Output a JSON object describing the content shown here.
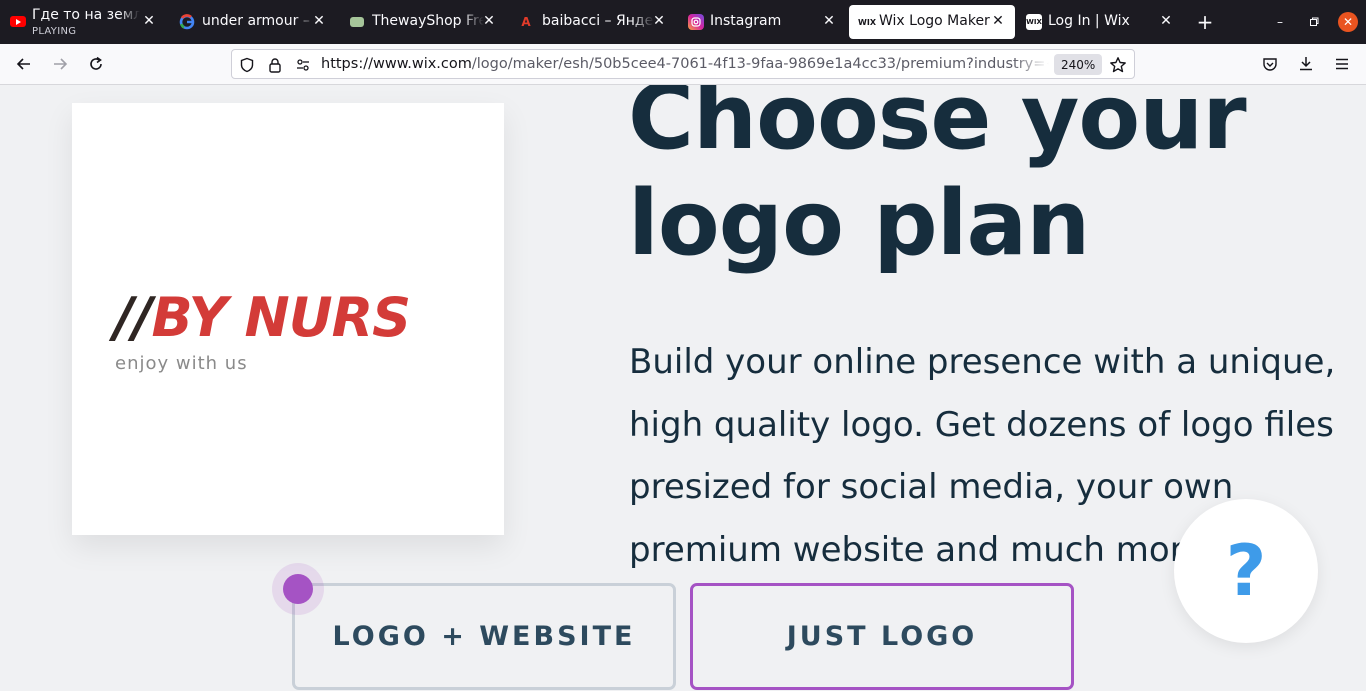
{
  "tabs": [
    {
      "title": "Где то на земле",
      "subtitle": "PLAYING",
      "favicon": "youtube-icon",
      "favicon_color": "#ff0000"
    },
    {
      "title": "under armour – G",
      "favicon": "google-icon",
      "favicon_color": "#4285f4"
    },
    {
      "title": "ThewayShop Free",
      "favicon": "site-icon",
      "favicon_color": "#a6c59a"
    },
    {
      "title": "baibacci – Яндекс",
      "favicon": "yandex-translate-icon",
      "favicon_color": "#e23b2a"
    },
    {
      "title": "Instagram",
      "favicon": "instagram-icon",
      "favicon_color": "#d6249f"
    },
    {
      "title": "Wix Logo Maker",
      "favicon": "wix-icon",
      "favicon_color": "#ffffff",
      "active": true
    },
    {
      "title": "Log In | Wix",
      "favicon": "wix-icon",
      "favicon_color": "#ffffff"
    }
  ],
  "toolbar": {
    "url_domain": "https://www.wix.com",
    "url_path": "/logo/maker/esh/50b5cee4-7061-4f13-9faa-9869e1a4cc33/premium?industry={\"industry",
    "zoom": "240%"
  },
  "page": {
    "logo": {
      "slash": "//",
      "name": "BY NURS",
      "tagline": "enjoy with us",
      "slash_color": "#2f2623",
      "name_color": "#d33b38"
    },
    "heading_line1": "Choose your",
    "heading_line2": "logo plan",
    "description_lines": [
      "Build your online presence with a unique,",
      "high quality logo. Get dozens of logo files",
      "presized for social media, your own",
      "premium website and much more"
    ],
    "btn_logo_website": "LOGO + WEBSITE",
    "btn_just_logo": "JUST LOGO",
    "help_label": "?",
    "accent_color": "#a553c4",
    "heading_color": "#162d3d"
  }
}
